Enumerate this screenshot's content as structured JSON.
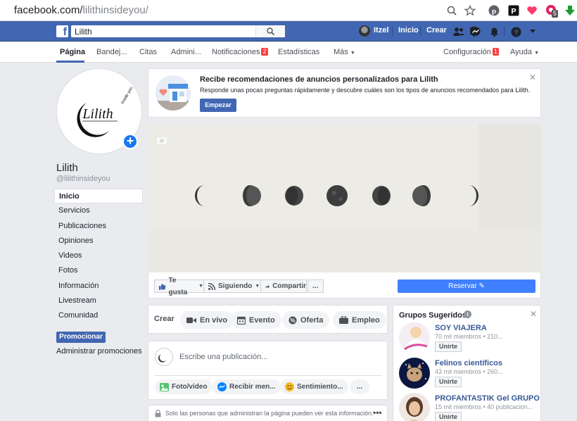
{
  "browser": {
    "url_host": "facebook.com/",
    "url_path": "lilithinsideyou/",
    "extension_badge": "5"
  },
  "topbar": {
    "search_value": "Lilith",
    "user_name": "Itzel",
    "home_label": "Inicio",
    "create_label": "Crear"
  },
  "tabs": {
    "pagina": "Página",
    "bandeja": "Bandej...",
    "citas": "Citas",
    "admin": "Admini...",
    "notificaciones": "Notificaciones",
    "notificaciones_badge": "2",
    "estadisticas": "Estadísticas",
    "mas": "Más",
    "configuracion": "Configuración",
    "configuracion_badge": "1",
    "ayuda": "Ayuda"
  },
  "profile": {
    "logo_text": "Lilith",
    "logo_sub": "inside you",
    "name": "Lilith",
    "handle": "@lilithinsideyou"
  },
  "sidebar": {
    "items": [
      {
        "label": "Inicio"
      },
      {
        "label": "Servicios"
      },
      {
        "label": "Publicaciones"
      },
      {
        "label": "Opiniones"
      },
      {
        "label": "Videos"
      },
      {
        "label": "Fotos"
      },
      {
        "label": "Información"
      },
      {
        "label": "Livestream"
      },
      {
        "label": "Comunidad"
      }
    ],
    "promote_label": "Promocionar",
    "admin_promos_label": "Administrar promociones"
  },
  "ad_recommend": {
    "title": "Recibe recomendaciones de anuncios personalizados para Lilith",
    "subtitle": "Responde unas pocas preguntas rápidamente y descubre cuáles son los tipos de anuncios recomendados para Lilith.",
    "button": "Empezar"
  },
  "actions": {
    "like": "Te gusta",
    "following": "Siguiendo",
    "share": "Compartir",
    "more": "...",
    "reserve": "Reservar"
  },
  "create": {
    "label": "Crear",
    "live": "En vivo",
    "event": "Evento",
    "offer": "Oferta",
    "job": "Empleo"
  },
  "composer": {
    "placeholder": "Escribe una publicación...",
    "photo_video": "Foto/video",
    "messages": "Recibir men...",
    "feeling": "Sentimiento...",
    "more": "..."
  },
  "admin_note": "Solo las personas que administran la página pueden ver esta información.",
  "groups": {
    "title": "Grupos Sugeridos",
    "join_label": "Unirte",
    "items": [
      {
        "name": "SOY VIAJERA",
        "meta": "70 mil miembros • 210..."
      },
      {
        "name": "Felinos científicos",
        "meta": "43 mil miembros • 260..."
      },
      {
        "name": "PROFANTASTIK Gel GRUPO",
        "meta": "15 mil miembros • 40 publicacion..."
      }
    ]
  }
}
